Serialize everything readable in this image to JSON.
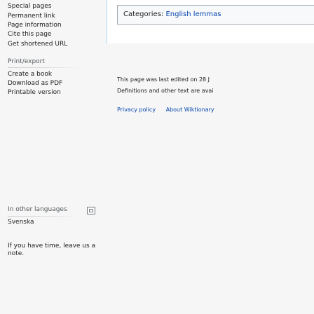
{
  "sidebar": {
    "tools": [
      {
        "label": "Special pages"
      },
      {
        "label": "Permanent link"
      },
      {
        "label": "Page information"
      },
      {
        "label": "Cite this page"
      },
      {
        "label": "Get shortened URL"
      }
    ],
    "print_heading": "Print/export",
    "print": [
      {
        "label": "Create a book"
      },
      {
        "label": "Download as PDF"
      },
      {
        "label": "Printable version"
      }
    ],
    "languages_heading": "In other languages",
    "languages_icon": "language-settings-icon",
    "languages": [
      {
        "label": "Svenska"
      }
    ],
    "note": "If you have time, leave us a note."
  },
  "content": {
    "categories_label": "Categories:",
    "categories": [
      "English lemmas"
    ],
    "footer": {
      "last_edited": "This page was last edited on 28 J",
      "license": "Definitions and other text are avai",
      "links": [
        "Privacy policy",
        "About Wiktionary"
      ]
    }
  },
  "colors": {
    "link": "#0645ad",
    "text": "#202122",
    "heading": "#54595d",
    "sidebar_bg": "#f6f6f6",
    "content_border": "#a7d7f9"
  }
}
